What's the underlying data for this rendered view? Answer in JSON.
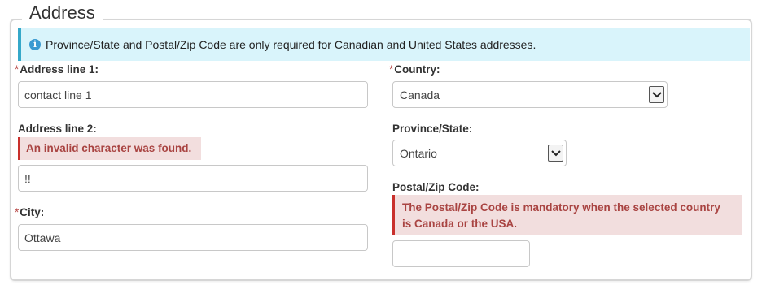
{
  "legend": "Address",
  "info": {
    "text": "Province/State and Postal/Zip Code are only required for Canadian and United States addresses.",
    "icon": "info-circle-icon"
  },
  "fields": {
    "address1": {
      "required_mark": "*",
      "label": "Address line 1:",
      "value": "contact line 1"
    },
    "address2": {
      "label": "Address line 2:",
      "error": "An invalid character was found.",
      "value": "!!"
    },
    "city": {
      "required_mark": "*",
      "label": "City:",
      "value": "Ottawa"
    },
    "country": {
      "required_mark": "*",
      "label": "Country:",
      "value": "Canada"
    },
    "province": {
      "label": "Province/State:",
      "value": "Ontario"
    },
    "postal": {
      "label": "Postal/Zip Code:",
      "error_line1": "The Postal/Zip Code is mandatory when the selected country",
      "error_line2": "is Canada or the USA.",
      "value": ""
    }
  },
  "colors": {
    "info_bg": "#d9f4fb",
    "info_border": "#35a8c9",
    "error_bg": "#f2dede",
    "error_text": "#a94442",
    "required": "#b94a48"
  }
}
